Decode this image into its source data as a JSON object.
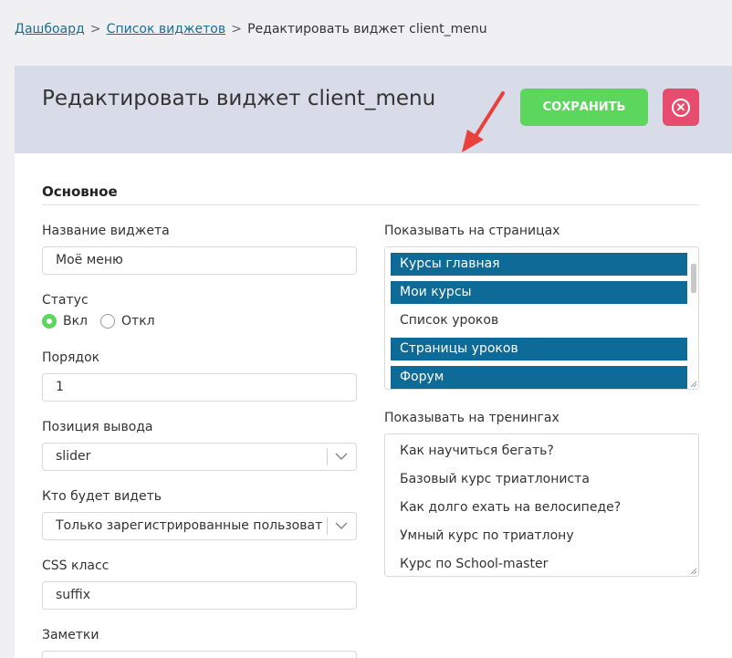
{
  "breadcrumb": {
    "items": [
      "Дашбоард",
      "Список виджетов"
    ],
    "current": "Редактировать виджет client_menu"
  },
  "header": {
    "title": "Редактировать виджет client_menu",
    "save_label": "СОХРАНИТЬ",
    "close_icon": "close-circle-icon",
    "arrow_icon": "red-pointer-arrow-icon"
  },
  "section": {
    "title": "Основное"
  },
  "form": {
    "name_label": "Название виджета",
    "name_value": "Моё меню",
    "status_label": "Статус",
    "status_on": "Вкл",
    "status_off": "Откл",
    "status_selected": "Вкл",
    "order_label": "Порядок",
    "order_value": "1",
    "position_label": "Позиция вывода",
    "position_value": "slider",
    "audience_label": "Кто будет видеть",
    "audience_value": "Только зарегистрированные пользователи",
    "css_label": "CSS класс",
    "css_value": "suffix",
    "notes_label": "Заметки"
  },
  "pages": {
    "label": "Показывать на страницах",
    "options": [
      {
        "text": "Курсы главная",
        "selected": true
      },
      {
        "text": "Мои курсы",
        "selected": true
      },
      {
        "text": "Список уроков",
        "selected": false
      },
      {
        "text": "Страницы уроков",
        "selected": true
      },
      {
        "text": "Форум",
        "selected": true
      }
    ]
  },
  "trainings": {
    "label": "Показывать на тренингах",
    "options": [
      {
        "text": "Как научиться бегать?",
        "selected": false
      },
      {
        "text": "Базовый курс триатлониста",
        "selected": false
      },
      {
        "text": "Как долго ехать на велосипеде?",
        "selected": false
      },
      {
        "text": "Умный курс по триатлону",
        "selected": false
      },
      {
        "text": "Курс по School-master",
        "selected": false
      }
    ]
  },
  "colors": {
    "header_bg": "#d8dbe8",
    "save_bg": "#5cd65c",
    "close_bg": "#e74c6f",
    "selected_option_bg": "#0e6a96",
    "link": "#1a6e96",
    "arrow": "#e8413c"
  }
}
